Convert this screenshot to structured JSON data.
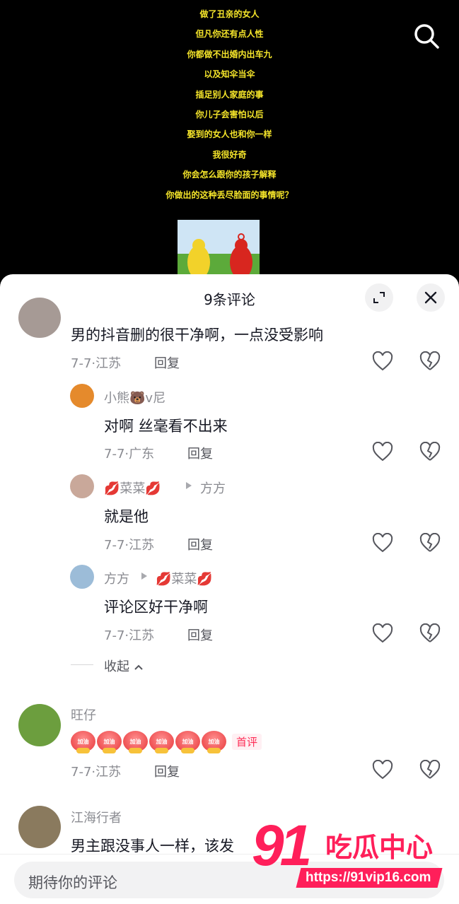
{
  "video": {
    "lyrics": [
      "做了丑亲的女人",
      "但凡你还有点人性",
      "你都做不出婚内出车九",
      "以及知伞当伞",
      "插足别人家庭的事",
      "你儿子会害怕以后",
      "娶到的女人也和你一样",
      "我很好奇",
      "你会怎么跟你的孩子解释",
      "你做出的这种丢尽脸面的事情呢？"
    ]
  },
  "sheet": {
    "title": "9条评论",
    "comments": [
      {
        "text": "男的抖音删的很干净啊，一点没受影响",
        "date": "7-7·江苏",
        "reply": "回复"
      },
      {
        "user": "小熊🐻v尼",
        "text": "对啊 丝毫看不出来",
        "date": "7-7·广东",
        "reply": "回复"
      },
      {
        "user": "💋菜菜💋",
        "reply_to": "方方",
        "text": "就是他",
        "date": "7-7·江苏",
        "reply": "回复"
      },
      {
        "user": "方方",
        "reply_to": "💋菜菜💋",
        "text": "评论区好干净啊",
        "date": "7-7·江苏",
        "reply": "回复"
      },
      {
        "user": "旺仔",
        "emoji_label": "加油",
        "badge": "首评",
        "date": "7-7·江苏",
        "reply": "回复"
      },
      {
        "user": "江海行者",
        "text": "男主跟没事人一样，该发"
      }
    ],
    "collapse": "收起",
    "composer_placeholder": "期待你的评论"
  },
  "watermark": {
    "logo_number": "91",
    "logo_text": "吃瓜中心",
    "url": "https://91vip16.com"
  }
}
